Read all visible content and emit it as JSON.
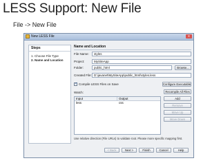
{
  "slide": {
    "title": "LESS Support: New File",
    "subtitle": "File -> New File"
  },
  "dialog": {
    "title": "New LESS File",
    "close_label": "x",
    "steps": {
      "header": "Steps",
      "items": [
        "1.    Choose File Type",
        "2.    Name and Location"
      ]
    },
    "section_header": "Name and Location",
    "fields": {
      "file_name_label": "File Name:",
      "file_name_value": "styles",
      "project_label": "Project:",
      "project_value": "MySiteApp",
      "folder_label": "Folder:",
      "folder_value": "public_html",
      "browse_label": "Browse...",
      "created_file_label": "Created File:",
      "created_file_value": "D:\\javanet\\MySiteApp\\public_html\\styles.less"
    },
    "compile_checkbox_label": "Compile LESS Files on Save",
    "configure_button": "Configure Executables...",
    "watch_label": "Watch:",
    "recompile_button": "Recompile All Files",
    "table": {
      "headers": [
        "Input",
        "Output"
      ],
      "rows": [
        [
          "less",
          "css"
        ]
      ]
    },
    "side_buttons": [
      "Add",
      "Remove",
      "Move Up",
      "Move Down"
    ],
    "footer_note": "Use relative direction (File URLs) to validate root. Please more specific mapping first.",
    "buttons": [
      "< Back",
      "Next >",
      "Finish",
      "Cancel",
      "Help"
    ]
  }
}
